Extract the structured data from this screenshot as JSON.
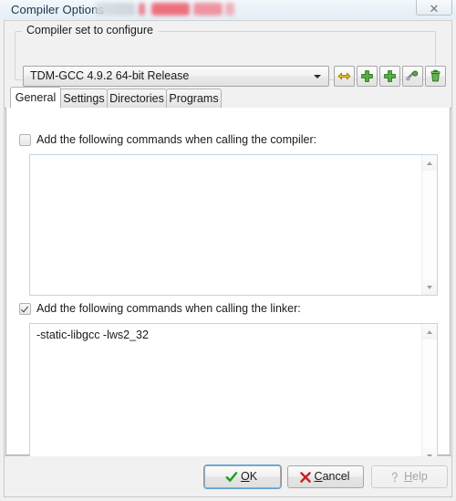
{
  "window": {
    "title": "Compiler Options",
    "title_redacted_note": "redacted text",
    "close_icon": "close-icon",
    "close_glyph": "✕"
  },
  "groupbox": {
    "label": "Compiler set to configure",
    "combo": {
      "selected": "TDM-GCC 4.9.2 64-bit Release",
      "arrow_icon": "chevron-down-icon"
    },
    "tools": [
      {
        "name": "rename-compiler-set-button",
        "icon": "yellow-double-arrow-icon"
      },
      {
        "name": "add-compiler-set-button",
        "icon": "green-plus-icon"
      },
      {
        "name": "duplicate-compiler-set-button",
        "icon": "green-plus-icon"
      },
      {
        "name": "configure-compiler-set-button",
        "icon": "wrench-icon"
      },
      {
        "name": "delete-compiler-set-button",
        "icon": "green-trash-icon"
      }
    ]
  },
  "tabs": [
    {
      "label": "General",
      "active": true
    },
    {
      "label": "Settings",
      "active": false
    },
    {
      "label": "Directories",
      "active": false
    },
    {
      "label": "Programs",
      "active": false
    }
  ],
  "general": {
    "compiler": {
      "checkbox_label": "Add the following commands when calling the compiler:",
      "checked": false,
      "text": ""
    },
    "linker": {
      "checkbox_label": "Add the following commands when calling the linker:",
      "checked": true,
      "text": "-static-libgcc -lws2_32"
    }
  },
  "buttons": {
    "ok": {
      "label_pre": "",
      "accel": "O",
      "label_post": "K",
      "icon": "check-icon",
      "enabled": true,
      "focused": true
    },
    "cancel": {
      "label_pre": "",
      "accel": "C",
      "label_post": "ancel",
      "icon": "x-icon",
      "enabled": true,
      "focused": false
    },
    "help": {
      "label_pre": "",
      "accel": "H",
      "label_post": "elp",
      "icon": "question-icon",
      "enabled": false,
      "focused": false
    }
  },
  "colors": {
    "accent_blue": "#58a5d8",
    "ok_green": "#2f9e2f",
    "cancel_red": "#cc2020",
    "title_blue": "#16334d"
  }
}
